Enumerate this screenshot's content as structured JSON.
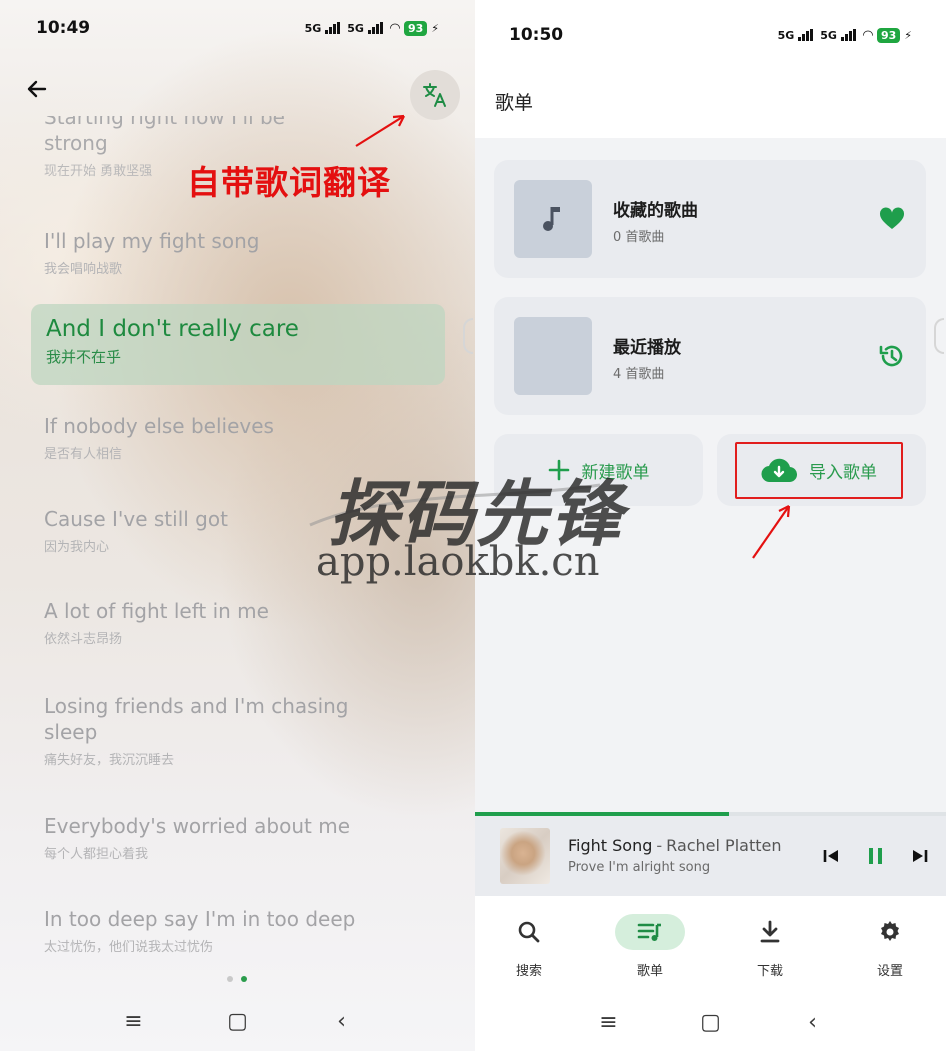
{
  "left": {
    "status": {
      "time": "10:49",
      "net1": "5G",
      "net2": "5G",
      "battery": "93"
    },
    "annotation": "自带歌词翻译",
    "lyrics": [
      {
        "en": "Starting right now I'll be strong",
        "en_l1": "Starting right now I'll be",
        "en_l2": "strong",
        "zh": "现在开始 勇敢坚强"
      },
      {
        "en": "I'll play my fight song",
        "zh": "我会唱响战歌"
      },
      {
        "en": "And I don't really care",
        "zh": "我并不在乎"
      },
      {
        "en": "If nobody else believes",
        "zh": "是否有人相信"
      },
      {
        "en": "Cause I've still got",
        "zh": "因为我内心"
      },
      {
        "en": "A lot of fight left in me",
        "zh": "依然斗志昂扬"
      },
      {
        "en_l1": "Losing friends and I'm chasing",
        "en_l2": "sleep",
        "zh": "痛失好友，我沉沉睡去"
      },
      {
        "en": "Everybody's worried about me",
        "zh": "每个人都担心着我"
      },
      {
        "en": "In too deep say I'm in too deep",
        "zh": "太过忧伤，他们说我太过忧伤"
      }
    ]
  },
  "right": {
    "status": {
      "time": "10:50",
      "net1": "5G",
      "net2": "5G",
      "battery": "93"
    },
    "title": "歌单",
    "playlists": [
      {
        "name": "收藏的歌曲",
        "count": "0 首歌曲"
      },
      {
        "name": "最近播放",
        "count": "4 首歌曲"
      }
    ],
    "actions": {
      "new": "新建歌单",
      "import": "导入歌单"
    },
    "now_playing": {
      "title": "Fight Song",
      "sep": "-",
      "artist": "Rachel Platten",
      "lyric": "Prove I'm alright song",
      "progress": 0.54
    },
    "tabs": [
      {
        "label": "搜索"
      },
      {
        "label": "歌单"
      },
      {
        "label": "下载"
      },
      {
        "label": "设置"
      }
    ]
  },
  "watermark": {
    "cn": "探码先锋",
    "url": "app.laokbk.cn"
  },
  "colors": {
    "accent": "#1f9e4c",
    "annotation": "#e41010"
  }
}
